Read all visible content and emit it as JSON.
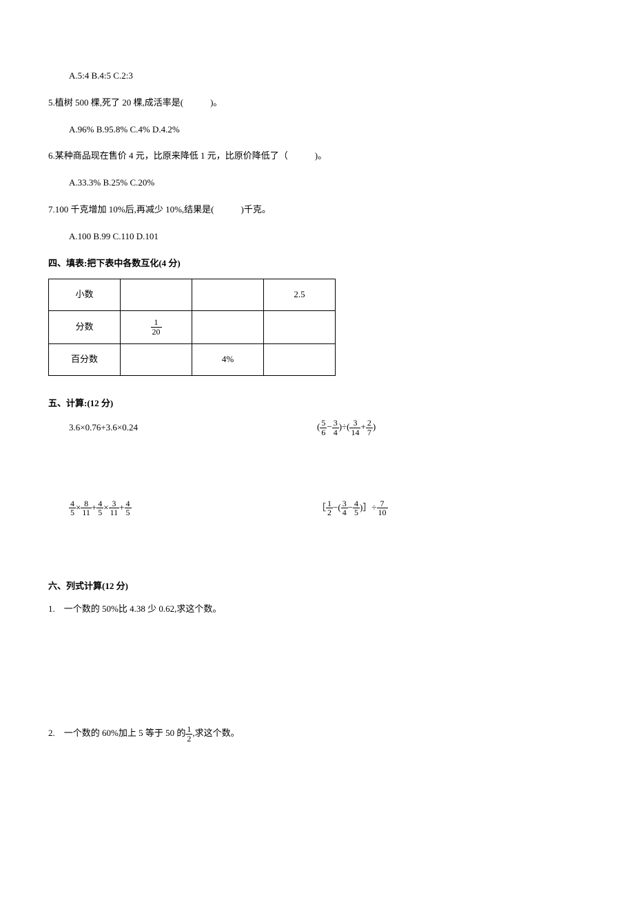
{
  "q4_options": "A.5:4   B.4:5   C.2:3",
  "q5": "5.植树 500 棵,死了 20 棵,成活率是(　　　)。",
  "q5_options": "A.96%   B.95.8%   C.4%   D.4.2%",
  "q6": "6.某种商品现在售价 4 元，比原来降低 1 元，比原价降低了（　　　)。",
  "q6_options": "A.33.3%    B.25%    C.20%",
  "q7": "7.100 千克增加 10%后,再减少 10%,结果是(　　　)千克。",
  "q7_options": "A.100  B.99  C.110  D.101",
  "section4_title": "四、填表:把下表中各数互化(4 分)",
  "table": {
    "r1c1": "小数",
    "r1c4": "2.5",
    "r2c1": "分数",
    "r2c2_num": "1",
    "r2c2_den": "20",
    "r3c1": "百分数",
    "r3c3": "4%"
  },
  "section5_title": "五、计算:(12 分)",
  "calc1": "3.6×0.76+3.6×0.24",
  "section6_title": "六、列式计算(12 分)",
  "p6_1": "1.　一个数的 50%比 4.38 少 0.62,求这个数。",
  "p6_2a": "2.　一个数的 60%加上 5 等于 50 的",
  "p6_2_num": "1",
  "p6_2_den": "2",
  "p6_2b": ",求这个数。",
  "chart_data": {
    "type": "table",
    "title": "把下表中各数互化",
    "columns": [
      "",
      "col1",
      "col2",
      "col3"
    ],
    "rows": [
      {
        "label": "小数",
        "values": [
          "",
          "",
          "2.5"
        ]
      },
      {
        "label": "分数",
        "values": [
          "1/20",
          "",
          ""
        ]
      },
      {
        "label": "百分数",
        "values": [
          "",
          "4%",
          ""
        ]
      }
    ]
  }
}
